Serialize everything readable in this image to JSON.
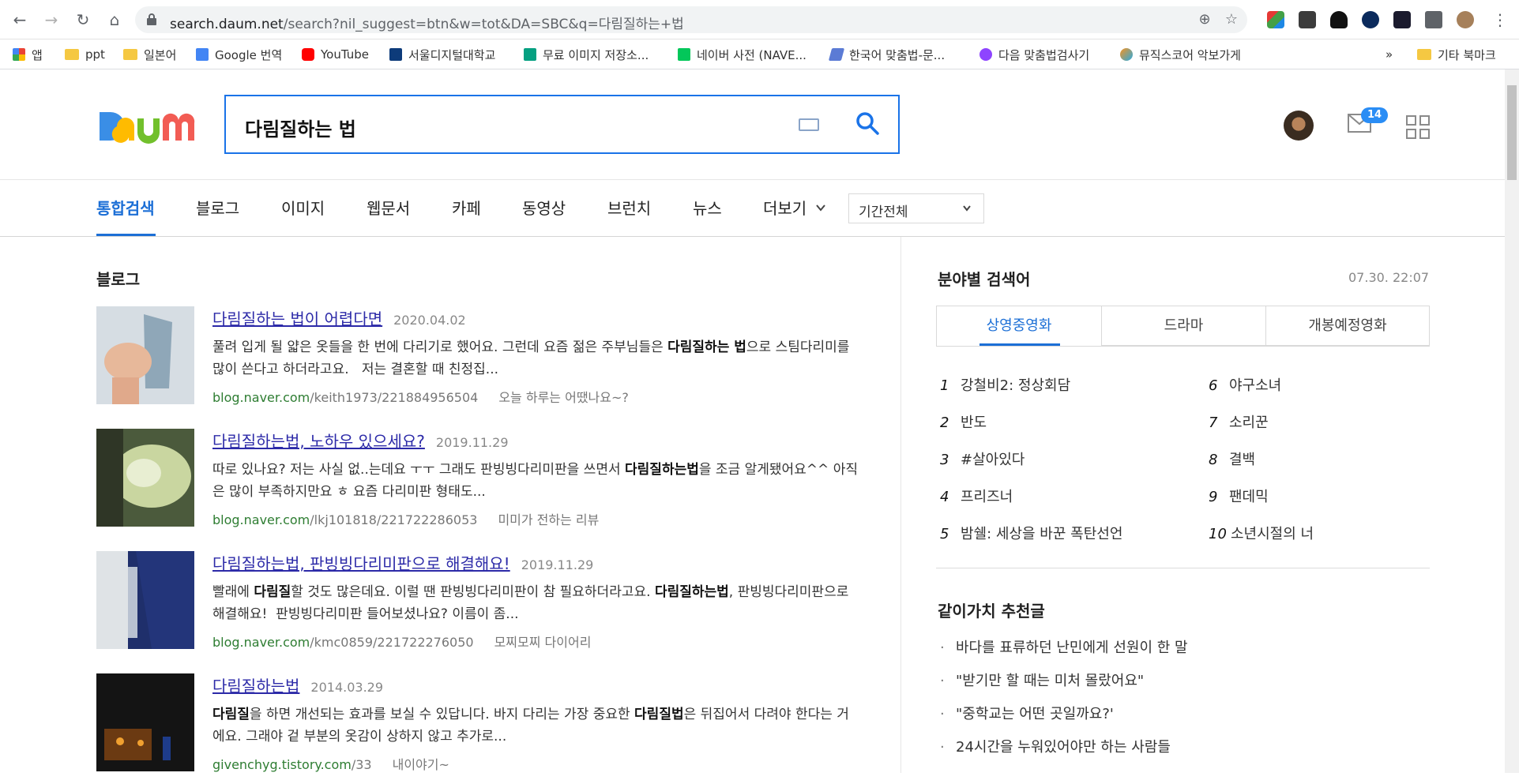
{
  "browser": {
    "url_host": "search.daum.net",
    "url_rest": "/search?nil_suggest=btn&w=tot&DA=SBC&q=다림질하는+법"
  },
  "bookmarks": [
    {
      "label": "앱",
      "icon": "apps-grid-icon"
    },
    {
      "label": "ppt",
      "icon": "folder-icon"
    },
    {
      "label": "일본어",
      "icon": "folder-icon"
    },
    {
      "label": "Google 번역",
      "icon": "google-translate-icon"
    },
    {
      "label": "YouTube",
      "icon": "youtube-icon"
    },
    {
      "label": "서울디지털대학교",
      "icon": "sdu-icon"
    },
    {
      "label": "무료 이미지 저장소...",
      "icon": "px-icon"
    },
    {
      "label": "네이버 사전 (NAVE...",
      "icon": "naver-dictionary-icon"
    },
    {
      "label": "한국어 맞춤법-문...",
      "icon": "spellcheck-icon"
    },
    {
      "label": "다음 맞춤법검사기",
      "icon": "daum-icon"
    },
    {
      "label": "뮤직스코어 악보가게",
      "icon": "musicscore-icon"
    }
  ],
  "bookmarks_overflow": "»",
  "bookmarks_other": "기타 북마크",
  "search": {
    "query": "다림질하는 법"
  },
  "header": {
    "mail_count": "14"
  },
  "tabs": [
    "통합검색",
    "블로그",
    "이미지",
    "웹문서",
    "카페",
    "동영상",
    "브런치",
    "뉴스",
    "더보기"
  ],
  "period_select": "기간전체",
  "blog_section": {
    "title": "블로그",
    "results": [
      {
        "title": "다림질하는 법이 어렵다면",
        "date": "2020.04.02",
        "snippet_html": "풀려 입게 될 얇은 옷들을 한 번에 다리기로 했어요. 그런데 요즘 젊은 주부님들은 <b>다림질하는 법</b>으로 스팀다리미를 많이 쓴다고 하더라고요.&nbsp;&nbsp;&nbsp;저는 결혼할 때 친정집...",
        "url_host": "blog.naver.com",
        "url_path": "/keith1973/221884956504",
        "blog_name": "오늘 하루는 어땠나요~?"
      },
      {
        "title": "다림질하는법, 노하우 있으세요?",
        "date": "2019.11.29",
        "snippet_html": "따로 있나요? 저는 사실 없..는데요 ㅜㅜ 그래도 판빙빙다리미판을 쓰면서 <b>다림질하는법</b>을 조금 알게됐어요^^ 아직은 많이 부족하지만요 ㅎ 요즘 다리미판 형태도...",
        "url_host": "blog.naver.com",
        "url_path": "/lkj101818/221722286053",
        "blog_name": "미미가 전하는 리뷰"
      },
      {
        "title": "다림질하는법, 판빙빙다리미판으로 해결해요!",
        "date": "2019.11.29",
        "snippet_html": "빨래에 <b>다림질</b>할 것도 많은데요. 이럴 땐 판빙빙다리미판이 참 필요하더라고요. <b>다림질하는법</b>, 판빙빙다리미판으로 해결해요!&nbsp;&nbsp;판빙빙다리미판 들어보셨나요? 이름이 좀...",
        "url_host": "blog.naver.com",
        "url_path": "/kmc0859/221722276050",
        "blog_name": "모찌모찌 다이어리"
      },
      {
        "title": "다림질하는법",
        "date": "2014.03.29",
        "snippet_html": "<b>다림질</b>을 하면 개선되는 효과를 보실 수 있답니다. 바지 다리는 가장 중요한 <b>다림질법</b>은 뒤집어서 다려야 한다는 거에요. 그래야 겉 부분의 옷감이 상하지 않고 추가로...",
        "url_host": "givenchyg.tistory.com",
        "url_path": "/33",
        "blog_name": "내이야기~"
      }
    ]
  },
  "ranking": {
    "title": "분야별 검색어",
    "time": "07.30. 22:07",
    "tabs": [
      "상영중영화",
      "드라마",
      "개봉예정영화"
    ],
    "items": [
      {
        "rank": "1",
        "label": "강철비2: 정상회담"
      },
      {
        "rank": "2",
        "label": "반도"
      },
      {
        "rank": "3",
        "label": "#살아있다"
      },
      {
        "rank": "4",
        "label": "프리즈너"
      },
      {
        "rank": "5",
        "label": "밤쉘: 세상을 바꾼 폭탄선언"
      },
      {
        "rank": "6",
        "label": "야구소녀"
      },
      {
        "rank": "7",
        "label": "소리꾼"
      },
      {
        "rank": "8",
        "label": "결백"
      },
      {
        "rank": "9",
        "label": "팬데믹"
      },
      {
        "rank": "10",
        "label": "소년시절의 너"
      }
    ]
  },
  "recommend": {
    "title": "같이가치 추천글",
    "items": [
      "바다를 표류하던 난민에게 선원이 한 말",
      "\"받기만 할 때는 미처 몰랐어요\"",
      "\"중학교는 어떤 곳일까요?'",
      "24시간을 누워있어야만 하는 사람들"
    ]
  }
}
